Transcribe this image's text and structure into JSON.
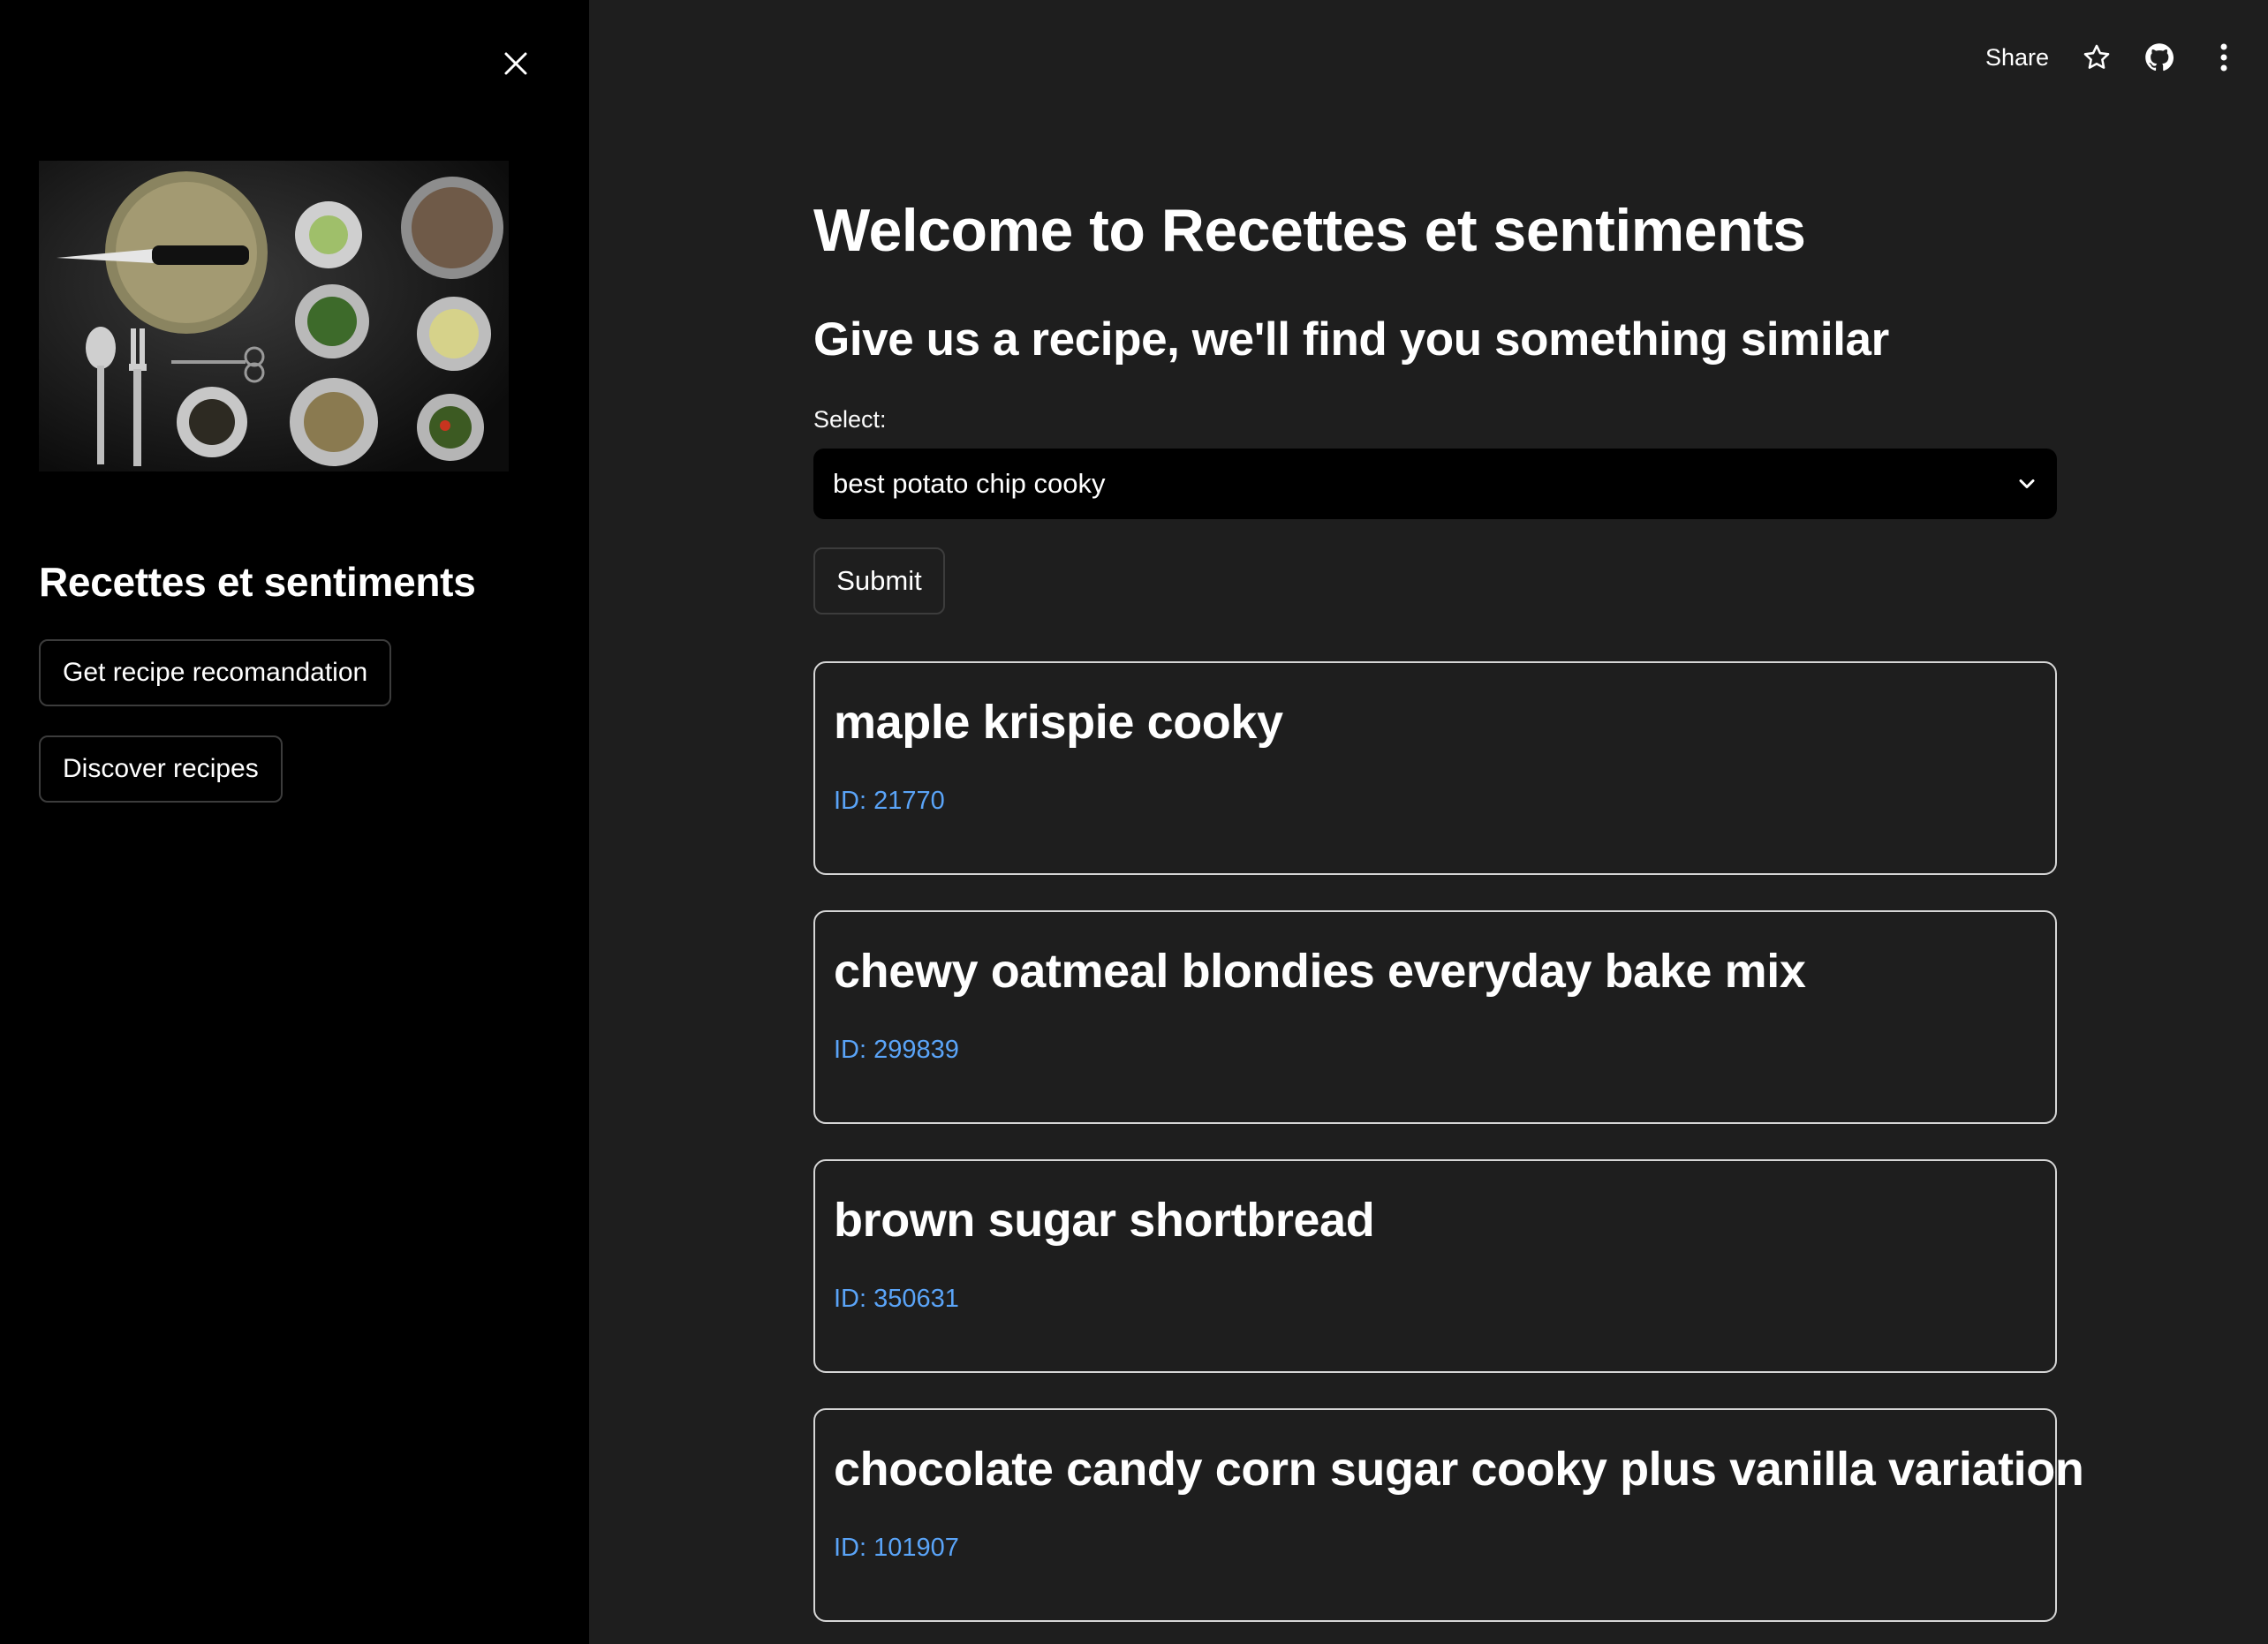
{
  "sidebar": {
    "title": "Recettes et sentiments",
    "buttons": [
      {
        "label": "Get recipe recomandation"
      },
      {
        "label": "Discover recipes"
      }
    ]
  },
  "toolbar": {
    "share_label": "Share",
    "icons": [
      "star-icon",
      "github-icon",
      "more-vertical-icon"
    ]
  },
  "main": {
    "title": "Welcome to Recettes et sentiments",
    "subtitle": "Give us a recipe, we'll find you something similar",
    "select": {
      "label": "Select:",
      "value": "best potato chip cooky"
    },
    "submit_label": "Submit",
    "results": [
      {
        "name": "maple krispie cooky",
        "id": "ID: 21770"
      },
      {
        "name": "chewy oatmeal blondies everyday bake mix",
        "id": "ID: 299839"
      },
      {
        "name": "brown sugar shortbread",
        "id": "ID: 350631"
      },
      {
        "name": "chocolate candy corn sugar cooky plus vanilla variation",
        "id": "ID: 101907"
      }
    ]
  },
  "colors": {
    "sidebar_bg": "#000000",
    "main_bg": "#1e1e1e",
    "link_blue": "#5aa4f8"
  }
}
